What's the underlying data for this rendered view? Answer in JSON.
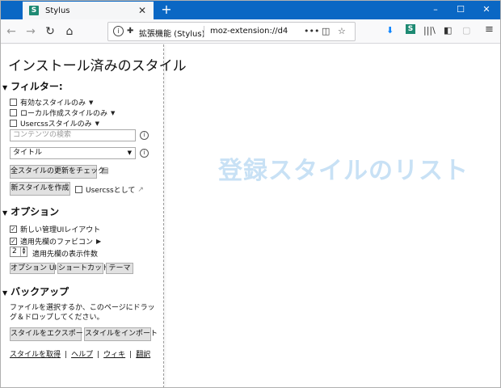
{
  "browser": {
    "tab": {
      "favicon": "S",
      "title": "Stylus",
      "close": "✕"
    },
    "new_tab": "+",
    "window": {
      "minimize": "–",
      "maximize": "☐",
      "close": "✕"
    },
    "nav": {
      "back": "←",
      "forward": "→",
      "reload": "↻",
      "home": "⌂"
    },
    "url": {
      "info": "i",
      "extension_name": "拡張機能 (Stylus)",
      "address": "moz-extension://d4",
      "more": "•••",
      "pocket": "◫",
      "bookmark": "☆"
    },
    "toolbar": {
      "download": "⬇",
      "stylus": "S",
      "library": "|||\\",
      "sidebar": "◧",
      "reader": "▢",
      "menu": "≡"
    }
  },
  "panel": {
    "title": "インストール済みのスタイル",
    "filters": {
      "heading": "フィルター:",
      "enabled_only": "有効なスタイルのみ",
      "local_only": "ローカル作成スタイルのみ",
      "usercss_only": "Usercssスタイルのみ",
      "search_placeholder": "コンテンツの検索",
      "sort_select": "タイトル",
      "check_updates": "全スタイルの更新をチェック",
      "new_style": "新スタイルを作成",
      "as_usercss": "Usercssとして"
    },
    "options": {
      "heading": "オプション",
      "new_layout": "新しい管理UIレイアウト",
      "new_layout_checked": true,
      "favicons": "適用先欄のファビコン",
      "favicons_checked": true,
      "count_value": "2",
      "count_label": "適用先欄の表示件数",
      "btn_options_ui": "オプション UI",
      "btn_shortcuts": "ショートカット",
      "btn_theme": "テーマ"
    },
    "backup": {
      "heading": "バックアップ",
      "description": "ファイルを選択するか、このページにドラッグ＆ドロップしてください。",
      "export": "スタイルをエクスポート",
      "import": "スタイルをインポート"
    },
    "links": {
      "get_styles": "スタイルを取得",
      "help": "ヘルプ",
      "wiki": "ウィキ",
      "translate": "翻訳",
      "sep": "|"
    }
  },
  "main": {
    "placeholder": "登録スタイルのリスト"
  },
  "colors": {
    "titlebar": "#0a67c4",
    "placeholder_text": "#c8e1f5",
    "stylus_icon": "#1e8a73"
  }
}
